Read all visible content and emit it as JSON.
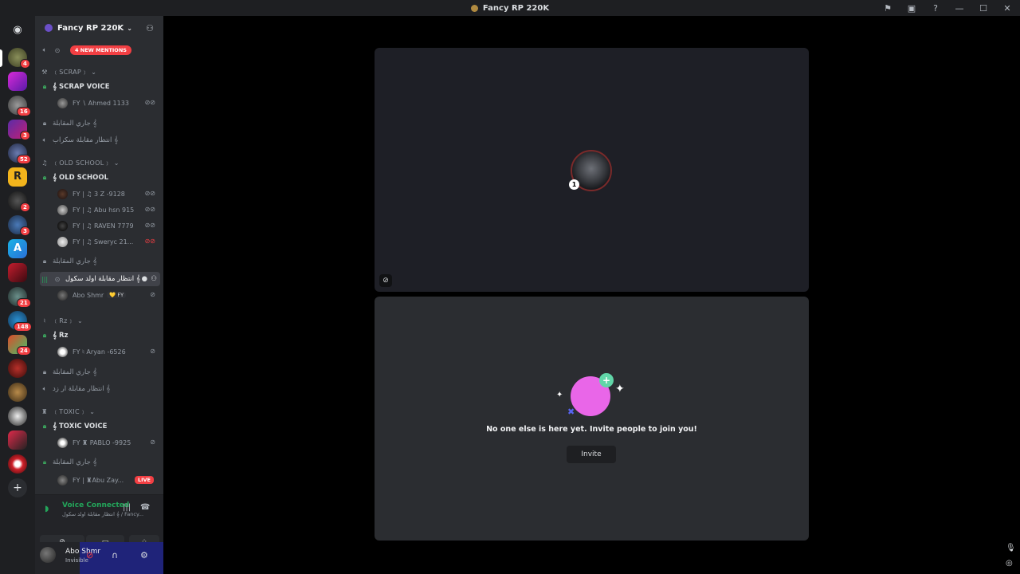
{
  "window": {
    "title": "Fancy RP 220K",
    "controls": [
      "⚑",
      "▣",
      "?",
      "—",
      "☐",
      "✕"
    ]
  },
  "rail_badges": [
    {
      "label": "4"
    },
    {
      "label": "16"
    },
    {
      "label": "3"
    },
    {
      "label": "52"
    },
    {
      "label": "2"
    },
    {
      "label": "3"
    },
    {
      "label": "21"
    },
    {
      "label": "148"
    },
    {
      "label": "24"
    }
  ],
  "server": {
    "name": "Fancy RP 220K"
  },
  "sidebar": {
    "mentions_label": "4 NEW MENTIONS",
    "cat_scrap": "﹝SCRAP﹞",
    "ch_scrap_voice": "𝄞 SCRAP VOICE",
    "u_ahmed": "FY ∖ Ahmed 1133",
    "ch_interview1": "جاري المقابلة 𝄞",
    "ch_wait_scrap": "انتظار مقابلة سكراب 𝄞",
    "cat_old": "﹝OLD SCHOOL﹞",
    "ch_old_school": "𝄞 OLD SCHOOL",
    "u_3z": "FY | ♫ 3 Z -9128",
    "u_abu": "FY | ♫ Abu hsn 915",
    "u_raven": "FY | ♫ RAVEN 7779",
    "u_swery": "FY | ♫ Sweryc 21...",
    "ch_interview2": "جاري المقابلة 𝄞",
    "ch_wait_old": "انتظار مقابلة اولد سكول 𝄞",
    "u_abo": "Abo Shmr",
    "u_abo_tag": "💛 FY",
    "cat_rz": "﹝Rz﹞",
    "ch_rz": "𝄞 Rz",
    "u_aryan": "FY ♮ Aryan -6526",
    "ch_interview3": "جاري المقابلة 𝄞",
    "ch_wait_rz": "انتظار مقابلة ار زد 𝄞",
    "cat_toxic": "﹝TOXIC﹞",
    "ch_toxic": "𝄞 TOXIC VOICE",
    "u_pablo": "FY ♜ PABLO -9925",
    "ch_interview4": "جاري المقابلة 𝄞",
    "u_abuzay": "FY | ♜Abu Zay...",
    "live_label": "LIVE"
  },
  "rtc": {
    "status": "Voice Connected",
    "channel": "انتظار مقابلة اولد سكول 𝄞 / Fancy..."
  },
  "panel": {
    "username": "Abo Shmr",
    "status": "Invisible"
  },
  "stage": {
    "empty_message": "No one else is here yet. Invite people to join you!",
    "invite_label": "Invite",
    "avatar_level": "1"
  },
  "colors": {
    "accent": "#5865f2",
    "online": "#23a55a",
    "danger": "#f23f43",
    "illustration": "#e966e8"
  }
}
